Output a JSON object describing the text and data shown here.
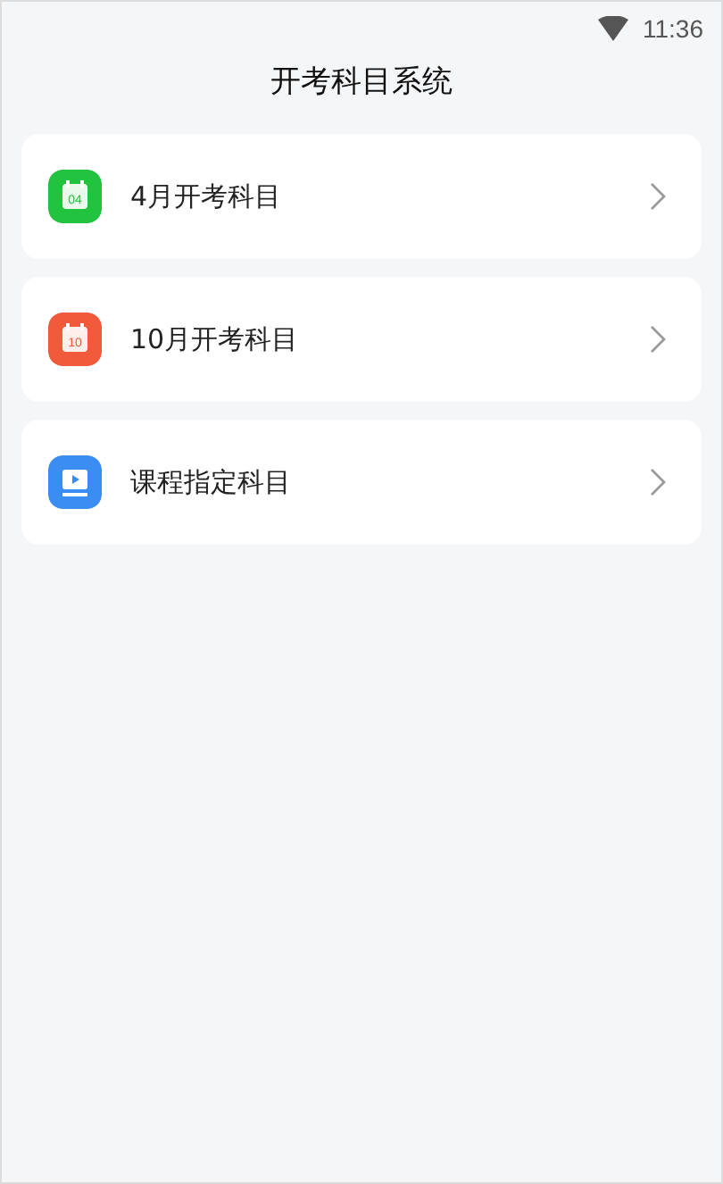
{
  "status_bar": {
    "time": "11:36"
  },
  "header": {
    "title": "开考科目系统"
  },
  "items": [
    {
      "label": "4月开考科目",
      "kind": "calendar",
      "icon_text": "04",
      "color": "#22c33e"
    },
    {
      "label": "10月开考科目",
      "kind": "calendar",
      "icon_text": "10",
      "color": "#f15a3a"
    },
    {
      "label": "课程指定科目",
      "kind": "video",
      "color": "#3a8ef3"
    }
  ]
}
